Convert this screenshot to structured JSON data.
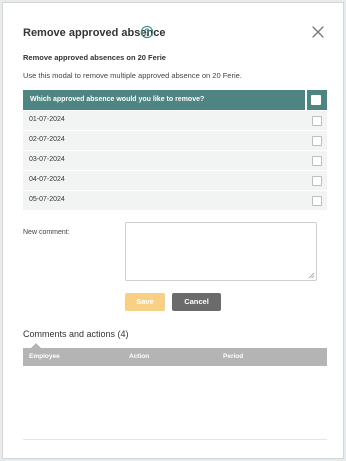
{
  "modal": {
    "title": "Remove approved absence",
    "subtitle": "Remove approved absences on 20 Ferie",
    "description": "Use this modal to remove multiple approved absence on 20 Ferie."
  },
  "table": {
    "header": "Which approved absence would you like to remove?",
    "rows": [
      {
        "date": "01-07-2024",
        "checked": false
      },
      {
        "date": "02-07-2024",
        "checked": false
      },
      {
        "date": "03-07-2024",
        "checked": false
      },
      {
        "date": "04-07-2024",
        "checked": false
      },
      {
        "date": "05-07-2024",
        "checked": false
      }
    ]
  },
  "comment": {
    "label": "New comment:",
    "value": ""
  },
  "buttons": {
    "save": "Save",
    "cancel": "Cancel"
  },
  "comments_section": {
    "title": "Comments and actions (4)",
    "columns": [
      "Employee",
      "Action",
      "Period"
    ]
  },
  "colors": {
    "table_header": "#4e8582",
    "save_button": "#f8d085",
    "cancel_button": "#6b6b6b",
    "icon_accent": "#3a8a87"
  },
  "icons": {
    "help": "help-circle-icon",
    "close": "close-icon"
  }
}
